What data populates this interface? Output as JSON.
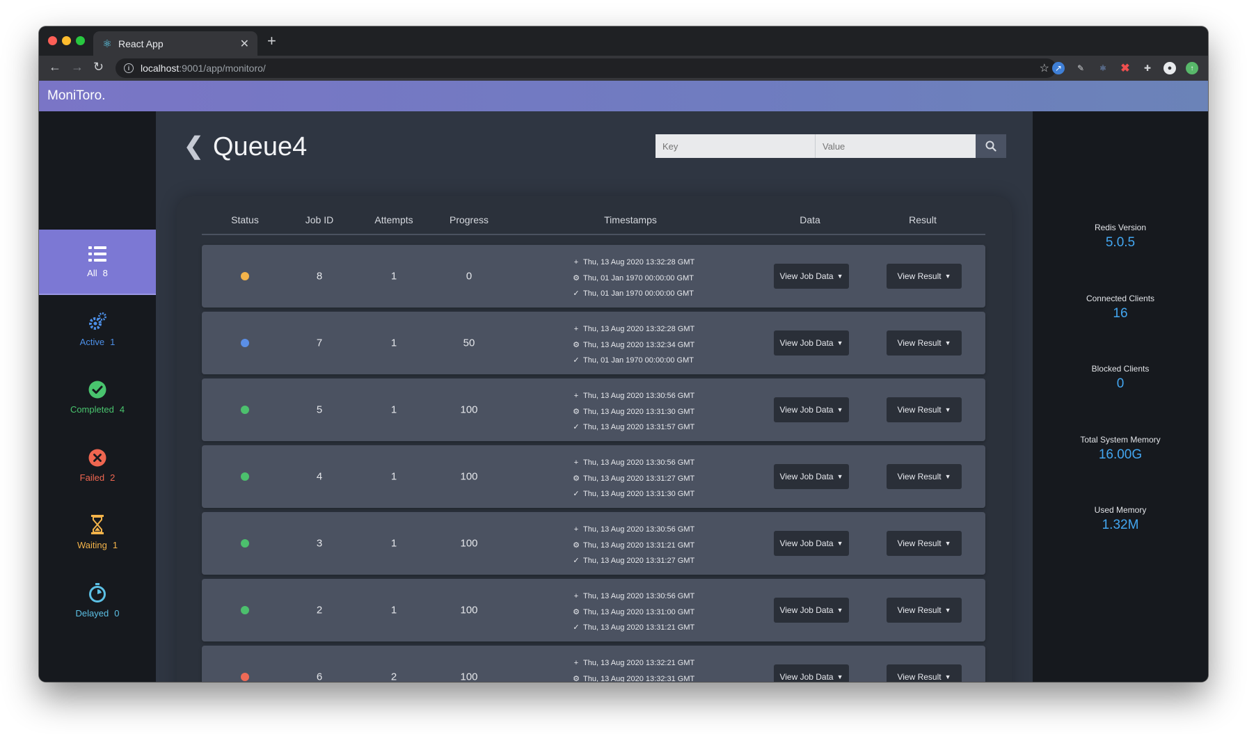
{
  "browser": {
    "tab_title": "React App",
    "url_host": "localhost",
    "url_path": ":9001/app/monitoro/"
  },
  "app": {
    "brand": "MoniToro."
  },
  "sidebar": {
    "items": [
      {
        "label": "All",
        "count": "8",
        "icon": "list-icon",
        "color": "#ffffff"
      },
      {
        "label": "Active",
        "count": "1",
        "icon": "gears-icon",
        "color": "#4d90e8"
      },
      {
        "label": "Completed",
        "count": "4",
        "icon": "check-circle-icon",
        "color": "#49c46e"
      },
      {
        "label": "Failed",
        "count": "2",
        "icon": "x-circle-icon",
        "color": "#ef6650"
      },
      {
        "label": "Waiting",
        "count": "1",
        "icon": "hourglass-icon",
        "color": "#f3b34a"
      },
      {
        "label": "Delayed",
        "count": "0",
        "icon": "stopwatch-icon",
        "color": "#5cc0e5"
      }
    ]
  },
  "main": {
    "title": "Queue4",
    "search": {
      "key_placeholder": "Key",
      "value_placeholder": "Value"
    },
    "columns": [
      "Status",
      "Job ID",
      "Attempts",
      "Progress",
      "Timestamps",
      "Data",
      "Result"
    ],
    "buttons": {
      "data": "View Job Data",
      "result": "View Result"
    },
    "status_colors": {
      "waiting": "#f3b34a",
      "active": "#5b8fe6",
      "completed": "#4cc06d",
      "failed": "#ef6a56"
    },
    "jobs": [
      {
        "status": "waiting",
        "id": "8",
        "attempts": "1",
        "progress": "0",
        "created": "Thu, 13 Aug 2020 13:32:28 GMT",
        "processed": "Thu, 01 Jan 1970 00:00:00 GMT",
        "finished": "Thu, 01 Jan 1970 00:00:00 GMT"
      },
      {
        "status": "active",
        "id": "7",
        "attempts": "1",
        "progress": "50",
        "created": "Thu, 13 Aug 2020 13:32:28 GMT",
        "processed": "Thu, 13 Aug 2020 13:32:34 GMT",
        "finished": "Thu, 01 Jan 1970 00:00:00 GMT"
      },
      {
        "status": "completed",
        "id": "5",
        "attempts": "1",
        "progress": "100",
        "created": "Thu, 13 Aug 2020 13:30:56 GMT",
        "processed": "Thu, 13 Aug 2020 13:31:30 GMT",
        "finished": "Thu, 13 Aug 2020 13:31:57 GMT"
      },
      {
        "status": "completed",
        "id": "4",
        "attempts": "1",
        "progress": "100",
        "created": "Thu, 13 Aug 2020 13:30:56 GMT",
        "processed": "Thu, 13 Aug 2020 13:31:27 GMT",
        "finished": "Thu, 13 Aug 2020 13:31:30 GMT"
      },
      {
        "status": "completed",
        "id": "3",
        "attempts": "1",
        "progress": "100",
        "created": "Thu, 13 Aug 2020 13:30:56 GMT",
        "processed": "Thu, 13 Aug 2020 13:31:21 GMT",
        "finished": "Thu, 13 Aug 2020 13:31:27 GMT"
      },
      {
        "status": "completed",
        "id": "2",
        "attempts": "1",
        "progress": "100",
        "created": "Thu, 13 Aug 2020 13:30:56 GMT",
        "processed": "Thu, 13 Aug 2020 13:31:00 GMT",
        "finished": "Thu, 13 Aug 2020 13:31:21 GMT"
      },
      {
        "status": "failed",
        "id": "6",
        "attempts": "2",
        "progress": "100",
        "created": "Thu, 13 Aug 2020 13:32:21 GMT",
        "processed": "Thu, 13 Aug 2020 13:32:31 GMT",
        "finished": ""
      }
    ]
  },
  "stats": [
    {
      "label": "Redis Version",
      "value": "5.0.5"
    },
    {
      "label": "Connected Clients",
      "value": "16"
    },
    {
      "label": "Blocked Clients",
      "value": "0"
    },
    {
      "label": "Total System Memory",
      "value": "16.00G"
    },
    {
      "label": "Used Memory",
      "value": "1.32M"
    }
  ]
}
